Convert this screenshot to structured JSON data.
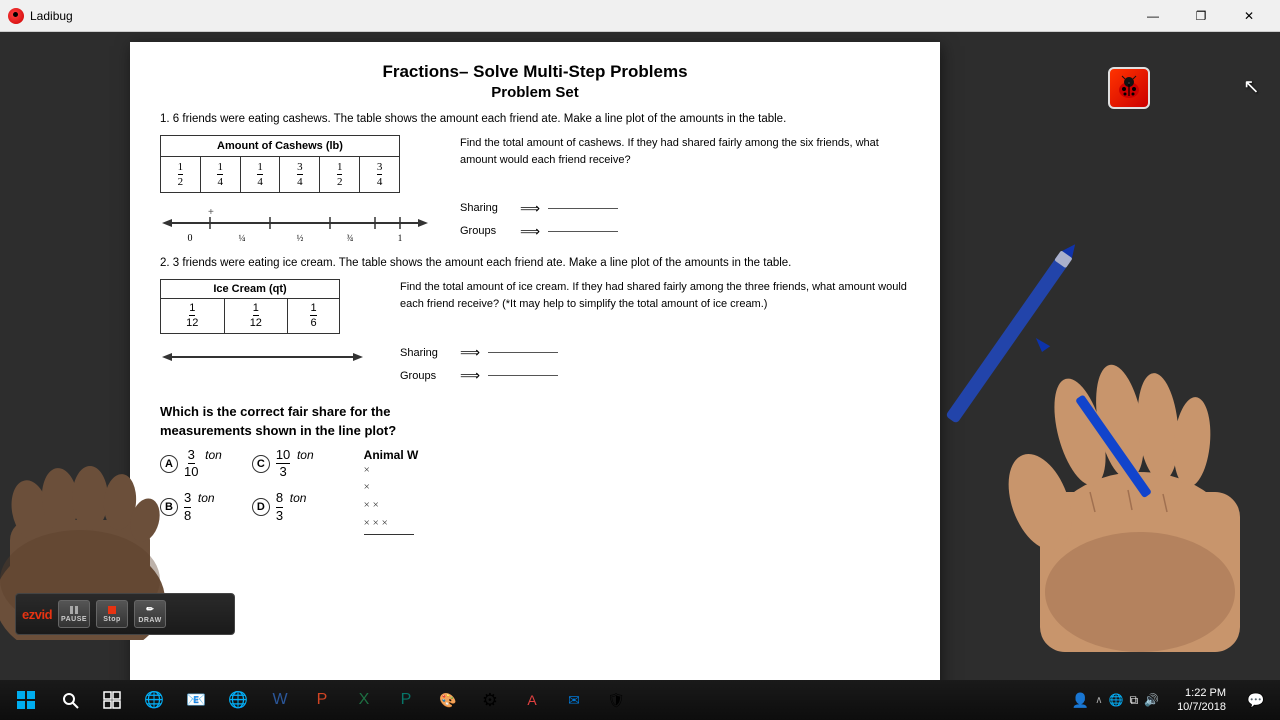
{
  "app": {
    "title": "Ladibug",
    "window_buttons": {
      "minimize": "—",
      "maximize": "❐",
      "close": "✕"
    }
  },
  "document": {
    "title": "Fractions– Solve Multi-Step Problems",
    "subtitle": "Problem Set",
    "problem1": {
      "text": "1.  6 friends were eating cashews. The table shows the amount\neach friend ate. Make a line plot of the amounts in the table.",
      "table_header": "Amount of Cashews (lb)",
      "table_values": [
        "1/2",
        "1/4",
        "1/4",
        "3/4",
        "1/2",
        "3/4"
      ],
      "side_question": "Find the total amount of cashews. If they had shared fairly among the six friends, what amount would each friend receive?",
      "sharing_label": "Sharing",
      "groups_label": "Groups"
    },
    "problem2": {
      "text": "2.  3 friends were eating ice cream. The table shows the amount each\nfriend ate. Make a line plot of the amounts in the table.",
      "table_header": "Ice Cream (qt)",
      "table_values": [
        "1/12",
        "1/12",
        "1/6"
      ],
      "side_question": "Find the total amount of ice cream. If they had shared fairly among the three friends, what amount would each friend receive? (*It may help to simplify the total amount of ice cream.)",
      "sharing_label": "Sharing",
      "groups_label": "Groups"
    },
    "bottom_question": {
      "text": "Which is the correct fair share for the\nmeasurements shown in the line plot?",
      "options": [
        {
          "label": "A",
          "value": "3/10 ton"
        },
        {
          "label": "B",
          "value": "3/8 ton"
        },
        {
          "label": "C",
          "value": "10/3 ton"
        },
        {
          "label": "D",
          "value": "8/3 ton"
        }
      ],
      "animal_label": "Animal W"
    }
  },
  "recorder": {
    "logo": "ezvid",
    "pause_label": "PAUSE",
    "stop_label": "Stop",
    "draw_label": "DRAW"
  },
  "taskbar": {
    "time": "1:22 PM",
    "date": "10/7/2018"
  },
  "cursor": {
    "symbol": "↖"
  }
}
